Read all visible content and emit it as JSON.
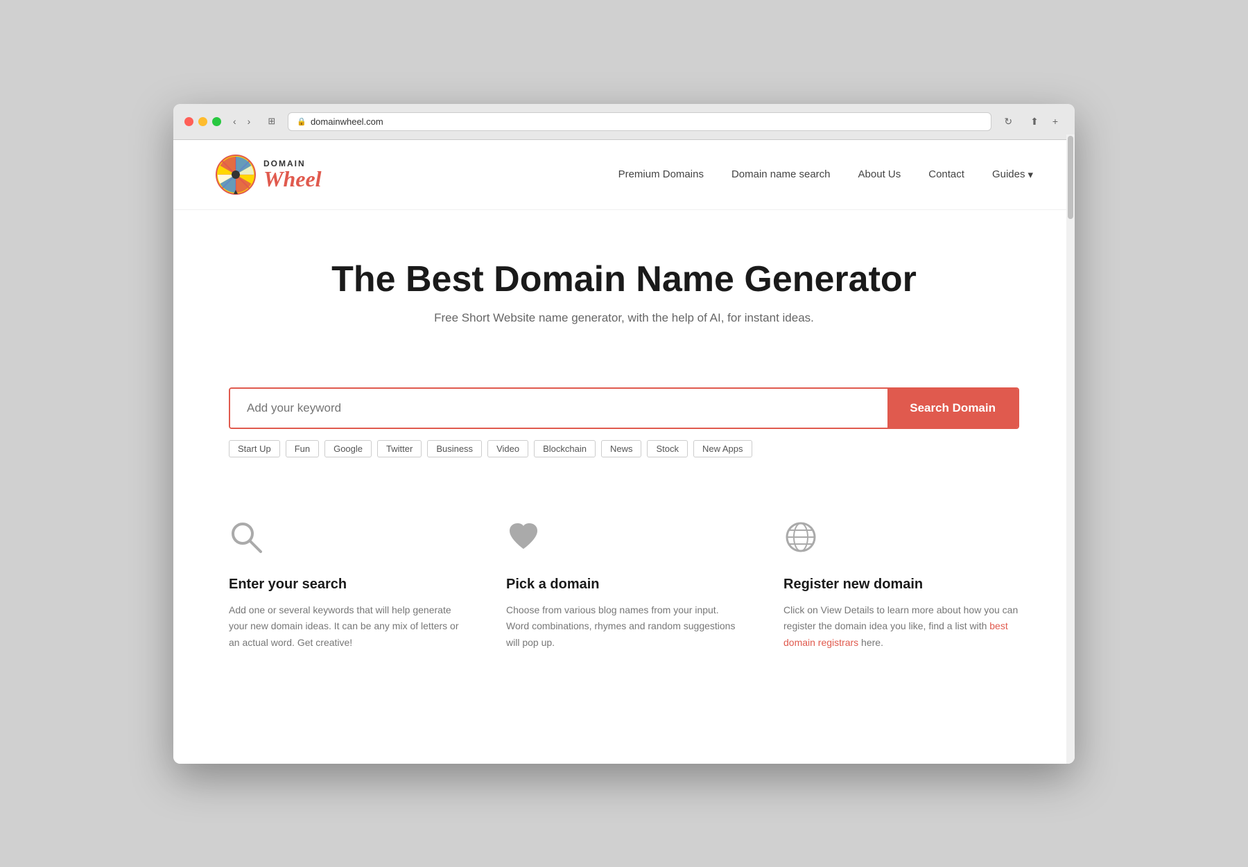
{
  "browser": {
    "url": "domainwheel.com",
    "nav_back": "‹",
    "nav_forward": "›",
    "tab_icon": "⊞",
    "reload": "↻",
    "share": "⬆",
    "newTab": "+"
  },
  "logo": {
    "domain_label": "DOMAIN",
    "wheel_label": "Wheel"
  },
  "nav": {
    "links": [
      {
        "label": "Premium Domains",
        "key": "premium-domains"
      },
      {
        "label": "Domain name search",
        "key": "domain-name-search"
      },
      {
        "label": "About Us",
        "key": "about-us"
      },
      {
        "label": "Contact",
        "key": "contact"
      },
      {
        "label": "Guides",
        "key": "guides"
      }
    ]
  },
  "hero": {
    "title": "The Best Domain Name Generator",
    "subtitle": "Free Short Website name generator, with the help of AI, for instant ideas."
  },
  "search": {
    "placeholder": "Add your keyword",
    "button_label": "Search Domain",
    "tags": [
      "Start Up",
      "Fun",
      "Google",
      "Twitter",
      "Business",
      "Video",
      "Blockchain",
      "News",
      "Stock",
      "New Apps"
    ]
  },
  "features": [
    {
      "key": "enter-search",
      "icon": "🔍",
      "icon_name": "search-icon",
      "title": "Enter your search",
      "desc": "Add one or several keywords that will help generate your new domain ideas. It can be any mix of letters or an actual word. Get creative!"
    },
    {
      "key": "pick-domain",
      "icon": "♥",
      "icon_name": "heart-icon",
      "title": "Pick a domain",
      "desc": "Choose from various blog names from your input. Word combinations, rhymes and random suggestions will pop up."
    },
    {
      "key": "register-domain",
      "icon": "🌐",
      "icon_name": "globe-icon",
      "title": "Register new domain",
      "desc_before": "Click on View Details to learn more about how you can register the domain idea you like, find a list with ",
      "desc_link": "best domain registrars",
      "desc_after": " here."
    }
  ]
}
